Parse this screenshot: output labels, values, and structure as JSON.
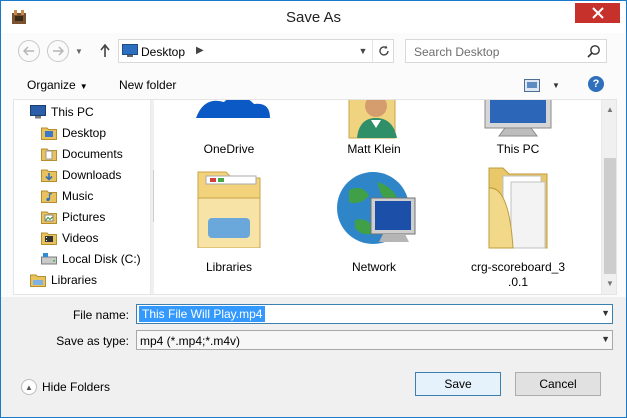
{
  "window": {
    "title": "Save As",
    "accent": "#1979ca",
    "close_color": "#c7312b"
  },
  "nav": {
    "back_icon": "back-arrow-icon",
    "forward_icon": "forward-arrow-icon",
    "up_icon": "up-arrow-icon",
    "address": "Desktop",
    "search_placeholder": "Search Desktop"
  },
  "toolbar": {
    "organize": "Organize",
    "new_folder": "New folder"
  },
  "sidebar": {
    "items": [
      {
        "label": "This PC",
        "icon": "computer-icon"
      },
      {
        "label": "Desktop",
        "icon": "desktop-folder-icon"
      },
      {
        "label": "Documents",
        "icon": "documents-icon"
      },
      {
        "label": "Downloads",
        "icon": "downloads-icon"
      },
      {
        "label": "Music",
        "icon": "music-icon"
      },
      {
        "label": "Pictures",
        "icon": "pictures-icon"
      },
      {
        "label": "Videos",
        "icon": "videos-icon"
      },
      {
        "label": "Local Disk (C:)",
        "icon": "disk-icon"
      },
      {
        "label": "Libraries",
        "icon": "libraries-icon"
      }
    ]
  },
  "files": [
    {
      "name": "OneDrive",
      "icon": "onedrive-icon"
    },
    {
      "name": "Matt Klein",
      "icon": "user-folder-icon"
    },
    {
      "name": "This PC",
      "icon": "computer-icon"
    },
    {
      "name": "Libraries",
      "icon": "libraries-icon"
    },
    {
      "name": "Network",
      "icon": "network-icon"
    },
    {
      "name": "crg-scoreboard_3",
      "name_line2": ".0.1",
      "icon": "folder-icon"
    }
  ],
  "form": {
    "file_name_label": "File name:",
    "file_name_value": "This File Will Play.mp4",
    "save_type_label": "Save as type:",
    "save_type_value": "mp4 (*.mp4;*.m4v)"
  },
  "footer": {
    "hide_folders": "Hide Folders",
    "save": "Save",
    "cancel": "Cancel"
  }
}
